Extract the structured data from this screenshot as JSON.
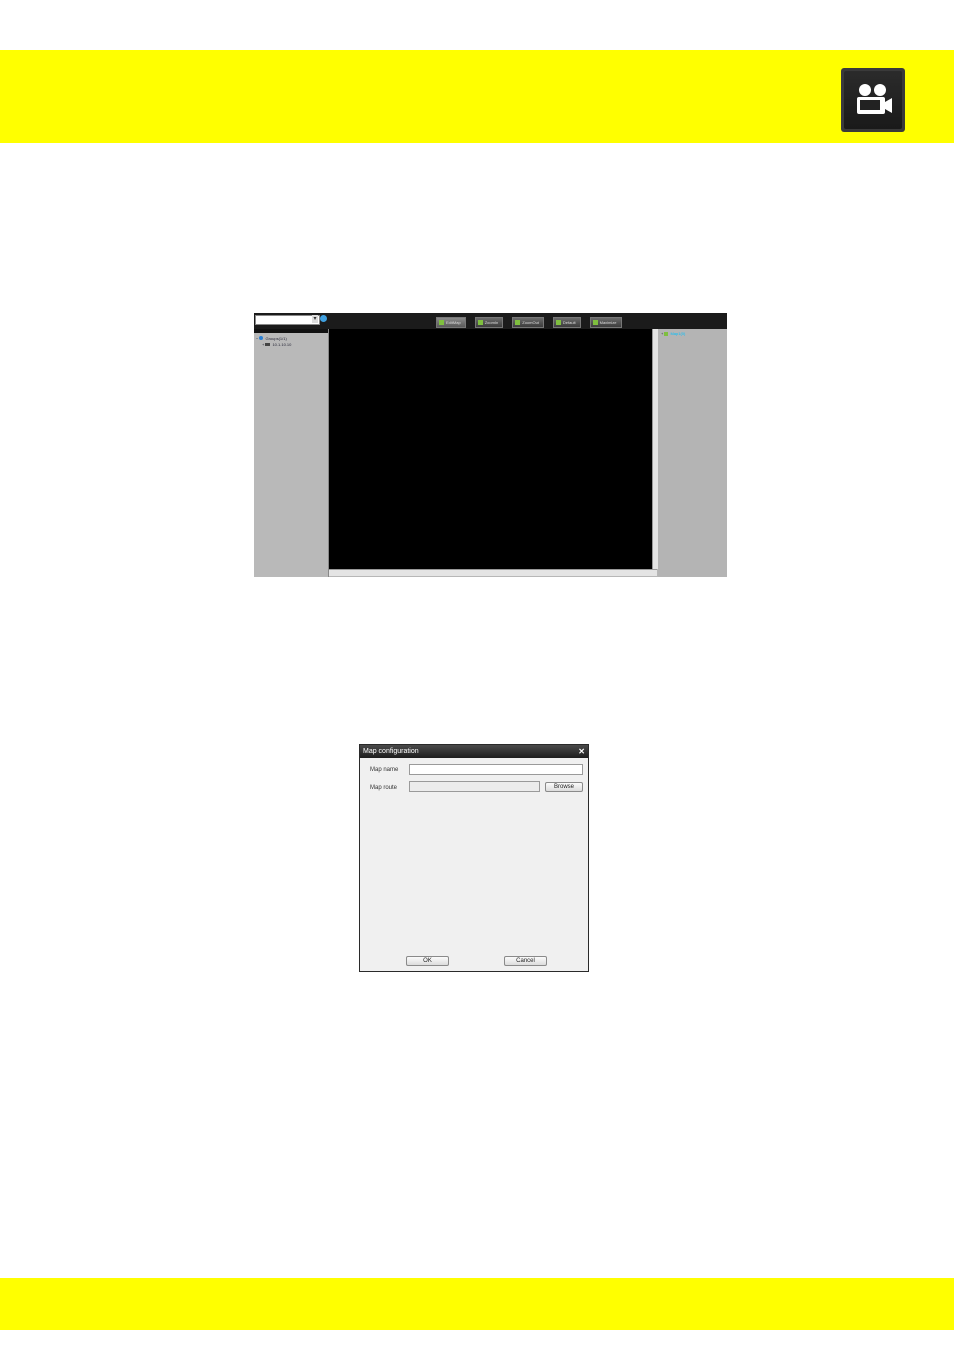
{
  "page": {
    "header_icon": "video-camera-icon",
    "brand_color": "#ffff00"
  },
  "screenshot1": {
    "tabs": [
      {
        "label": "EditMap",
        "active": true
      },
      {
        "label": "ZoomIn",
        "active": false
      },
      {
        "label": "ZoomOut",
        "active": false
      },
      {
        "label": "Default",
        "active": false
      },
      {
        "label": "Maximize",
        "active": false
      }
    ],
    "tree": {
      "group": "Groups(1/1)",
      "device": "10.1.10.10"
    },
    "map_list_item": "Map1(0)"
  },
  "dialog": {
    "title": "Map configuration",
    "map_name_label": "Map name",
    "map_route_label": "Map route",
    "browse_label": "Browse",
    "ok_label": "OK",
    "cancel_label": "Cancel"
  }
}
